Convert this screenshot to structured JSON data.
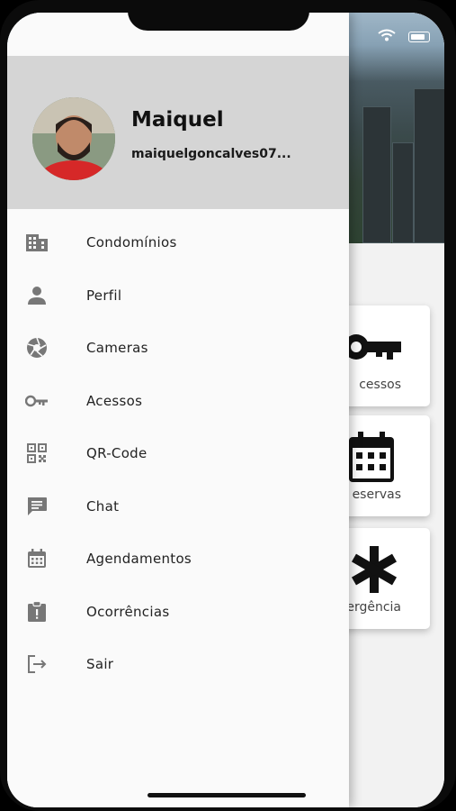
{
  "drawer": {
    "user_name": "Maiquel",
    "user_email": "maiquelgoncalves07...",
    "items": [
      {
        "label": "Condomínios",
        "icon": "building-icon"
      },
      {
        "label": "Perfil",
        "icon": "person-icon"
      },
      {
        "label": "Cameras",
        "icon": "camera-shutter-icon"
      },
      {
        "label": "Acessos",
        "icon": "key-icon"
      },
      {
        "label": "QR-Code",
        "icon": "qr-code-icon"
      },
      {
        "label": "Chat",
        "icon": "chat-icon"
      },
      {
        "label": "Agendamentos",
        "icon": "calendar-icon"
      },
      {
        "label": "Ocorrências",
        "icon": "clipboard-alert-icon"
      },
      {
        "label": "Sair",
        "icon": "logout-icon"
      }
    ]
  },
  "background": {
    "cards": [
      {
        "label": "cessos",
        "icon": "key-icon"
      },
      {
        "label": "eservas",
        "icon": "calendar-icon"
      },
      {
        "label": "ergência",
        "icon": "asterisk-icon"
      }
    ]
  },
  "colors": {
    "header_bg": "#d5d5d5",
    "drawer_bg": "#fafafa",
    "icon_gray": "#757575"
  }
}
